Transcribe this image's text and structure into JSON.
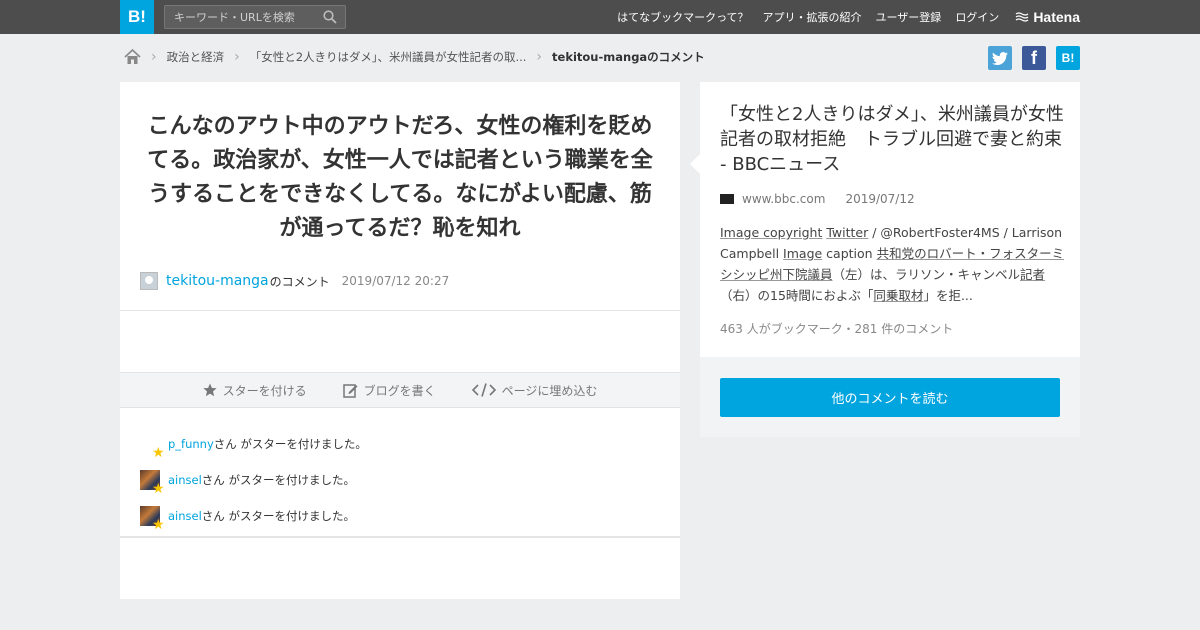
{
  "header": {
    "logo": "B!",
    "search_placeholder": "キーワード・URLを検索",
    "nav": [
      "はてなブックマークって？",
      "アプリ・拡張の紹介",
      "ユーザー登録",
      "ログイン"
    ],
    "hatena": "Hatena"
  },
  "breadcrumb": {
    "items": [
      "政治と経済",
      "「女性と2人きりはダメ」、米州議員が女性記者の取...",
      "tekitou-mangaのコメント"
    ]
  },
  "share": {
    "hatebu": "B!",
    "facebook": "f"
  },
  "comment": {
    "text": "こんなのアウト中のアウトだろ、女性の権利を貶めてる。政治家が、女性一人では記者という職業を全うすることをできなくしてる。なにがよい配慮、筋が通ってるだ？恥を知れ",
    "author": "tekitou-manga",
    "author_suffix": "のコメント",
    "date": "2019/07/12 20:27"
  },
  "actions": {
    "star": "スターを付ける",
    "blog": "ブログを書く",
    "embed": "ページに埋め込む"
  },
  "stars": {
    "suffix": "さん がスターを付けました。",
    "users": [
      "p_funny",
      "ainsel",
      "ainsel"
    ]
  },
  "entry": {
    "title": "「女性と2人きりはダメ」、米州議員が女性記者の取材拒絶　トラブル回避で妻と約束 - BBCニュース",
    "domain": "www.bbc.com",
    "date": "2019/07/12",
    "desc": {
      "p1": "Image copyright",
      "p2": " ",
      "p3": "Twitter",
      "p4": " / @RobertFoster4MS / Larrison Campbell ",
      "p5": "Image",
      "p6": " caption ",
      "p7": "共和党のロバート・フォスターミシシッピ州下院議員",
      "p8": "（左）は、ラリソン・キャンベル",
      "p9": "記者",
      "p10": "（右）の15時間におよぶ「",
      "p11": "同乗取材",
      "p12": "」を拒..."
    },
    "count": "463 人がブックマーク・281 件のコメント"
  },
  "read_more": "他のコメントを読む",
  "colors": {
    "accent": "#00a4de",
    "header_bg": "#4d4d4d",
    "star": "#f7c600"
  }
}
